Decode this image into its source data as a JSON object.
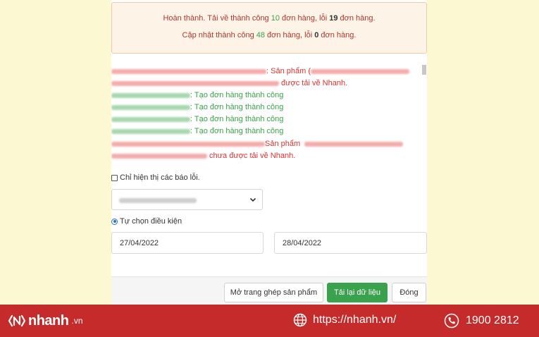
{
  "alert": {
    "line1_a": "Hoàn thành. Tải về thành công ",
    "line1_n1": "10",
    "line1_b": " đơn hàng, lỗi ",
    "line1_n2": "19",
    "line1_c": " đơn hàng.",
    "line2_a": "Cập nhật thành công ",
    "line2_n1": "48",
    "line2_b": " đơn hàng, lỗi ",
    "line2_n2": "0",
    "line2_c": " đơn hàng."
  },
  "log": {
    "product_prefix": ": Sản phẩm (",
    "downloaded_suffix": " được tải về Nhanh.",
    "success_text": ": Tạo đơn hàng thành công",
    "product_text": "Sản phẩm",
    "not_downloaded_suffix": " chưa được tải về Nhanh."
  },
  "filter": {
    "errors_only_label": "Chỉ hiện thị các báo lỗi.",
    "custom_condition_label": "Tự chọn điều kiện",
    "date_from": "27/04/2022",
    "date_to": "28/04/2022"
  },
  "buttons": {
    "open_mapping": "Mở trang ghép sản phẩm",
    "reload": "Tải lại dữ liệu",
    "close": "Đóng"
  },
  "brand": {
    "logo_name": "nhanh",
    "logo_tld": ".vn",
    "website": "https://nhanh.vn/",
    "phone": "1900 2812"
  },
  "colors": {
    "brand_red": "#c62b2b",
    "success_green": "#3aa14c",
    "error_red": "#e0312e"
  }
}
